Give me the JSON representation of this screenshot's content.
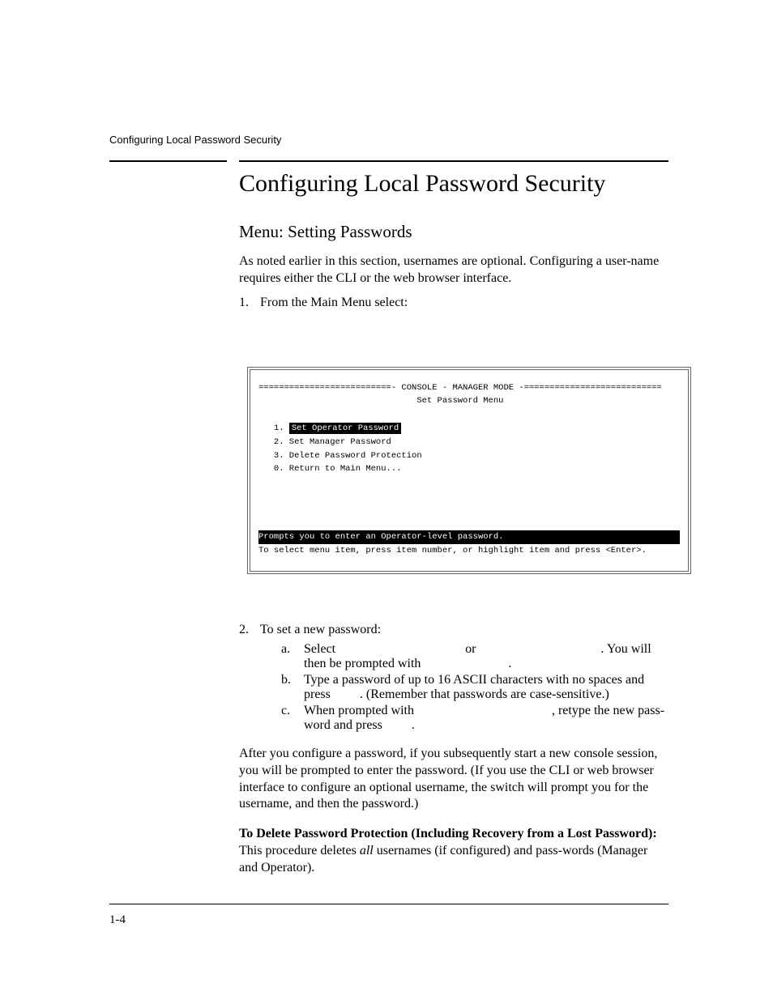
{
  "running_head": "Configuring Local Password Security",
  "title": "Configuring Local Password Security",
  "subtitle": "Menu: Setting Passwords",
  "intro": "As noted earlier in this section, usernames are optional. Configuring a user-name requires either the CLI or the web browser interface.",
  "step1_num": "1.",
  "step1_text": "From the Main Menu select:",
  "console": {
    "header_line": "==========================- CONSOLE - MANAGER MODE -===========================",
    "subheader": "                               Set Password Menu",
    "opt_prefix1": "   1. ",
    "opt1": "Set Operator Password",
    "opt2": "   2. Set Manager Password",
    "opt3": "   3. Delete Password Protection",
    "opt0": "   0. Return to Main Menu...",
    "status": "Prompts you to enter an Operator-level password.                               ",
    "help": "To select menu item, press item number, or highlight item and press <Enter>."
  },
  "step2_num": "2.",
  "step2_text": "To set a new password:",
  "s2a_num": "a.",
  "s2a_1": "Select ",
  "s2a_or": " or ",
  "s2a_2": ". You will then be prompted with ",
  "s2a_3": ".",
  "s2b_num": "b.",
  "s2b_1": "Type a password of up to 16 ASCII characters with no spaces and press ",
  "s2b_2": ". (Remember that passwords are case-sensitive.)",
  "s2c_num": "c.",
  "s2c_1": "When prompted with ",
  "s2c_2": ", retype the new pass-word and press ",
  "s2c_3": ".",
  "after": "After you configure a password, if you subsequently start a new console session, you will be prompted to enter the password. (If you use the CLI or web browser interface to configure an optional username, the switch will prompt you for the username, and then the password.)",
  "del_head": "To Delete Password Protection (Including Recovery from a Lost Password):  ",
  "del_body1": "This procedure deletes ",
  "del_all": "all",
  "del_body2": " usernames (if configured) and pass-words (Manager and Operator).",
  "page_num": "1-4"
}
